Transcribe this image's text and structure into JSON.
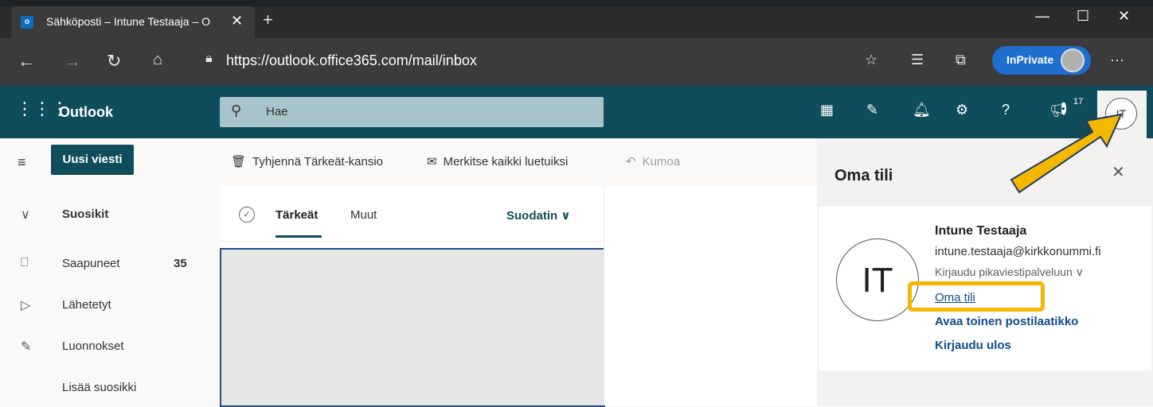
{
  "browser": {
    "tab_title": "Sähköposti – Intune Testaaja – O",
    "tab_close": "✕",
    "new_tab": "+",
    "url": "https://outlook.office365.com/mail/inbox",
    "inprivate_label": "InPrivate",
    "more": "···"
  },
  "header": {
    "app_name": "Outlook",
    "search_placeholder": "Hae",
    "notif_badge": "17",
    "avatar_initials": "IT"
  },
  "leftnav": {
    "new_message": "Uusi viesti",
    "favorites": "Suosikit",
    "items": [
      {
        "label": "Saapuneet",
        "count": "35"
      },
      {
        "label": "Lähetetyt",
        "count": ""
      },
      {
        "label": "Luonnokset",
        "count": ""
      },
      {
        "label": "Lisää suosikki",
        "count": ""
      }
    ]
  },
  "commands": {
    "empty_focused": "Tyhjennä Tärkeät-kansio",
    "mark_all_read": "Merkitse kaikki luetuiksi",
    "undo": "Kumoa"
  },
  "pivot": {
    "focused": "Tärkeät",
    "other": "Muut",
    "filter": "Suodatin"
  },
  "account": {
    "title": "Oma tili",
    "close": "✕",
    "initials": "IT",
    "name": "Intune Testaaja",
    "email": "intune.testaaja@kirkkonummi.fi",
    "im_signin": "Kirjaudu pikaviestipalveluun",
    "my_account": "Oma tili",
    "open_other_mailbox": "Avaa toinen postilaatikko",
    "sign_out": "Kirjaudu ulos"
  },
  "colors": {
    "header": "#0f4c5c",
    "highlight": "#f5b800",
    "link": "#0f4c8a"
  }
}
